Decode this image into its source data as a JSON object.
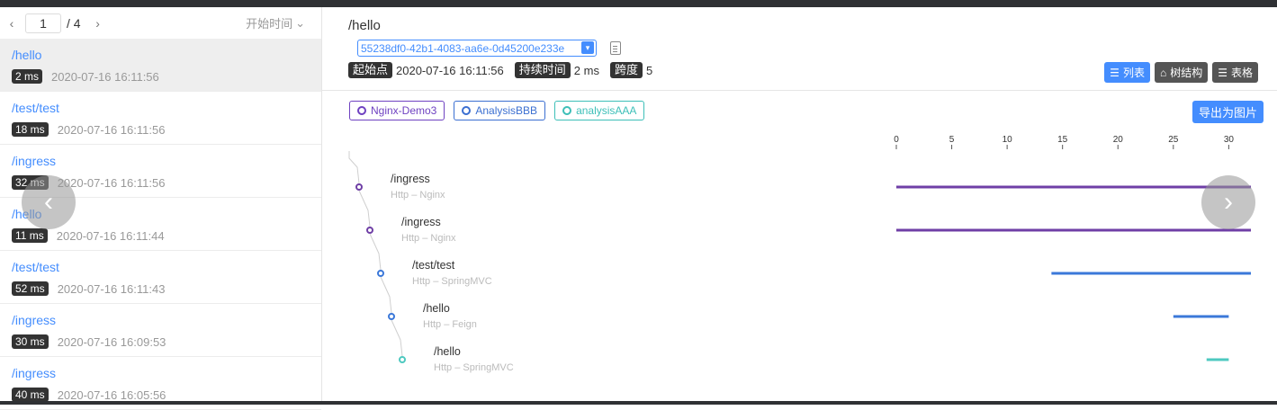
{
  "pager": {
    "current": "1",
    "total": "/ 4",
    "sort_label": "开始时间"
  },
  "traces": [
    {
      "name": "/hello",
      "duration": "2 ms",
      "time": "2020-07-16 16:11:56"
    },
    {
      "name": "/test/test",
      "duration": "18 ms",
      "time": "2020-07-16 16:11:56"
    },
    {
      "name": "/ingress",
      "duration": "32 ms",
      "time": "2020-07-16 16:11:56"
    },
    {
      "name": "/hello",
      "duration": "11 ms",
      "time": "2020-07-16 16:11:44"
    },
    {
      "name": "/test/test",
      "duration": "52 ms",
      "time": "2020-07-16 16:11:43"
    },
    {
      "name": "/ingress",
      "duration": "30 ms",
      "time": "2020-07-16 16:09:53"
    },
    {
      "name": "/ingress",
      "duration": "40 ms",
      "time": "2020-07-16 16:05:56"
    }
  ],
  "detail": {
    "title": "/hello",
    "trace_id": "55238df0-42b1-4083-aa6e-0d45200e233e",
    "start_label": "起始点",
    "start_value": "2020-07-16 16:11:56",
    "duration_label": "持续时间",
    "duration_value": "2 ms",
    "span_label": "跨度",
    "span_value": "5"
  },
  "view_buttons": {
    "list": "列表",
    "tree": "树结构",
    "table": "表格"
  },
  "export_label": "导出为图片",
  "services": [
    {
      "name": "Nginx-Demo3",
      "color": "#6f42c1"
    },
    {
      "name": "AnalysisBBB",
      "color": "#3b6fd1"
    },
    {
      "name": "analysisAAA",
      "color": "#3dbfb8"
    }
  ],
  "chart_data": {
    "type": "gantt",
    "axis_ticks": [
      0,
      5,
      10,
      15,
      20,
      25,
      30
    ],
    "xlim": [
      0,
      32
    ],
    "spans": [
      {
        "label": "/ingress",
        "sub": "Http – Nginx",
        "start": 0,
        "end": 32,
        "color": "#6f3fa6"
      },
      {
        "label": "/ingress",
        "sub": "Http – Nginx",
        "start": 0,
        "end": 32,
        "color": "#6f3fa6"
      },
      {
        "label": "/test/test",
        "sub": "Http – SpringMVC",
        "start": 14,
        "end": 32,
        "color": "#3b78d9"
      },
      {
        "label": "/hello",
        "sub": "Http – Feign",
        "start": 25,
        "end": 30,
        "color": "#3b78d9"
      },
      {
        "label": "/hello",
        "sub": "Http – SpringMVC",
        "start": 28,
        "end": 30,
        "color": "#4ec9c0"
      }
    ]
  }
}
